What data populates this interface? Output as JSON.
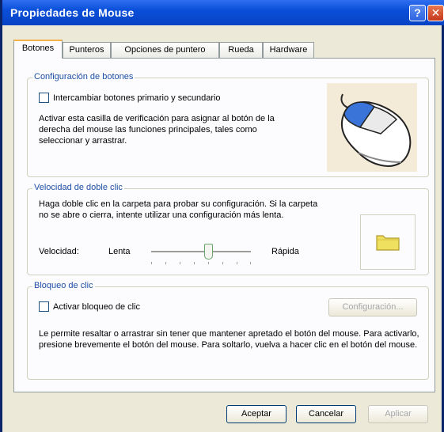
{
  "window": {
    "title": "Propiedades de Mouse",
    "help_glyph": "?",
    "close_glyph": "✕"
  },
  "tabs": [
    {
      "label": "Botones",
      "active": true
    },
    {
      "label": "Punteros",
      "active": false
    },
    {
      "label": "Opciones de puntero",
      "active": false
    },
    {
      "label": "Rueda",
      "active": false
    },
    {
      "label": "Hardware",
      "active": false
    }
  ],
  "button_config": {
    "legend": "Configuración de botones",
    "swap_checkbox_label": "Intercambiar botones primario y secundario",
    "swap_checked": false,
    "description": "Activar esta casilla de verificación para asignar al botón de la derecha del mouse las funciones principales, tales como seleccionar y arrastrar."
  },
  "double_click": {
    "legend": "Velocidad de doble clic",
    "description": "Haga doble clic en la carpeta para probar su configuración. Si la carpeta no se abre o cierra, intente utilizar una configuración más lenta.",
    "speed_label": "Velocidad:",
    "slow_label": "Lenta",
    "fast_label": "Rápida",
    "speed_fraction": 0.58
  },
  "click_lock": {
    "legend": "Bloqueo de clic",
    "checkbox_label": "Activar bloqueo de clic",
    "checked": false,
    "settings_button": "Configuración...",
    "description": "Le permite resaltar o arrastrar sin tener que mantener apretado el botón del mouse. Para activarlo, presione brevemente el botón del mouse. Para soltarlo, vuelva a hacer clic en el botón del mouse."
  },
  "footer": {
    "ok": "Aceptar",
    "cancel": "Cancelar",
    "apply": "Aplicar"
  },
  "colors": {
    "titlebar": "#0a4fd9",
    "legend": "#1e4fa5",
    "mouse_button": "#3a74d8",
    "folder": "#f0e060"
  }
}
